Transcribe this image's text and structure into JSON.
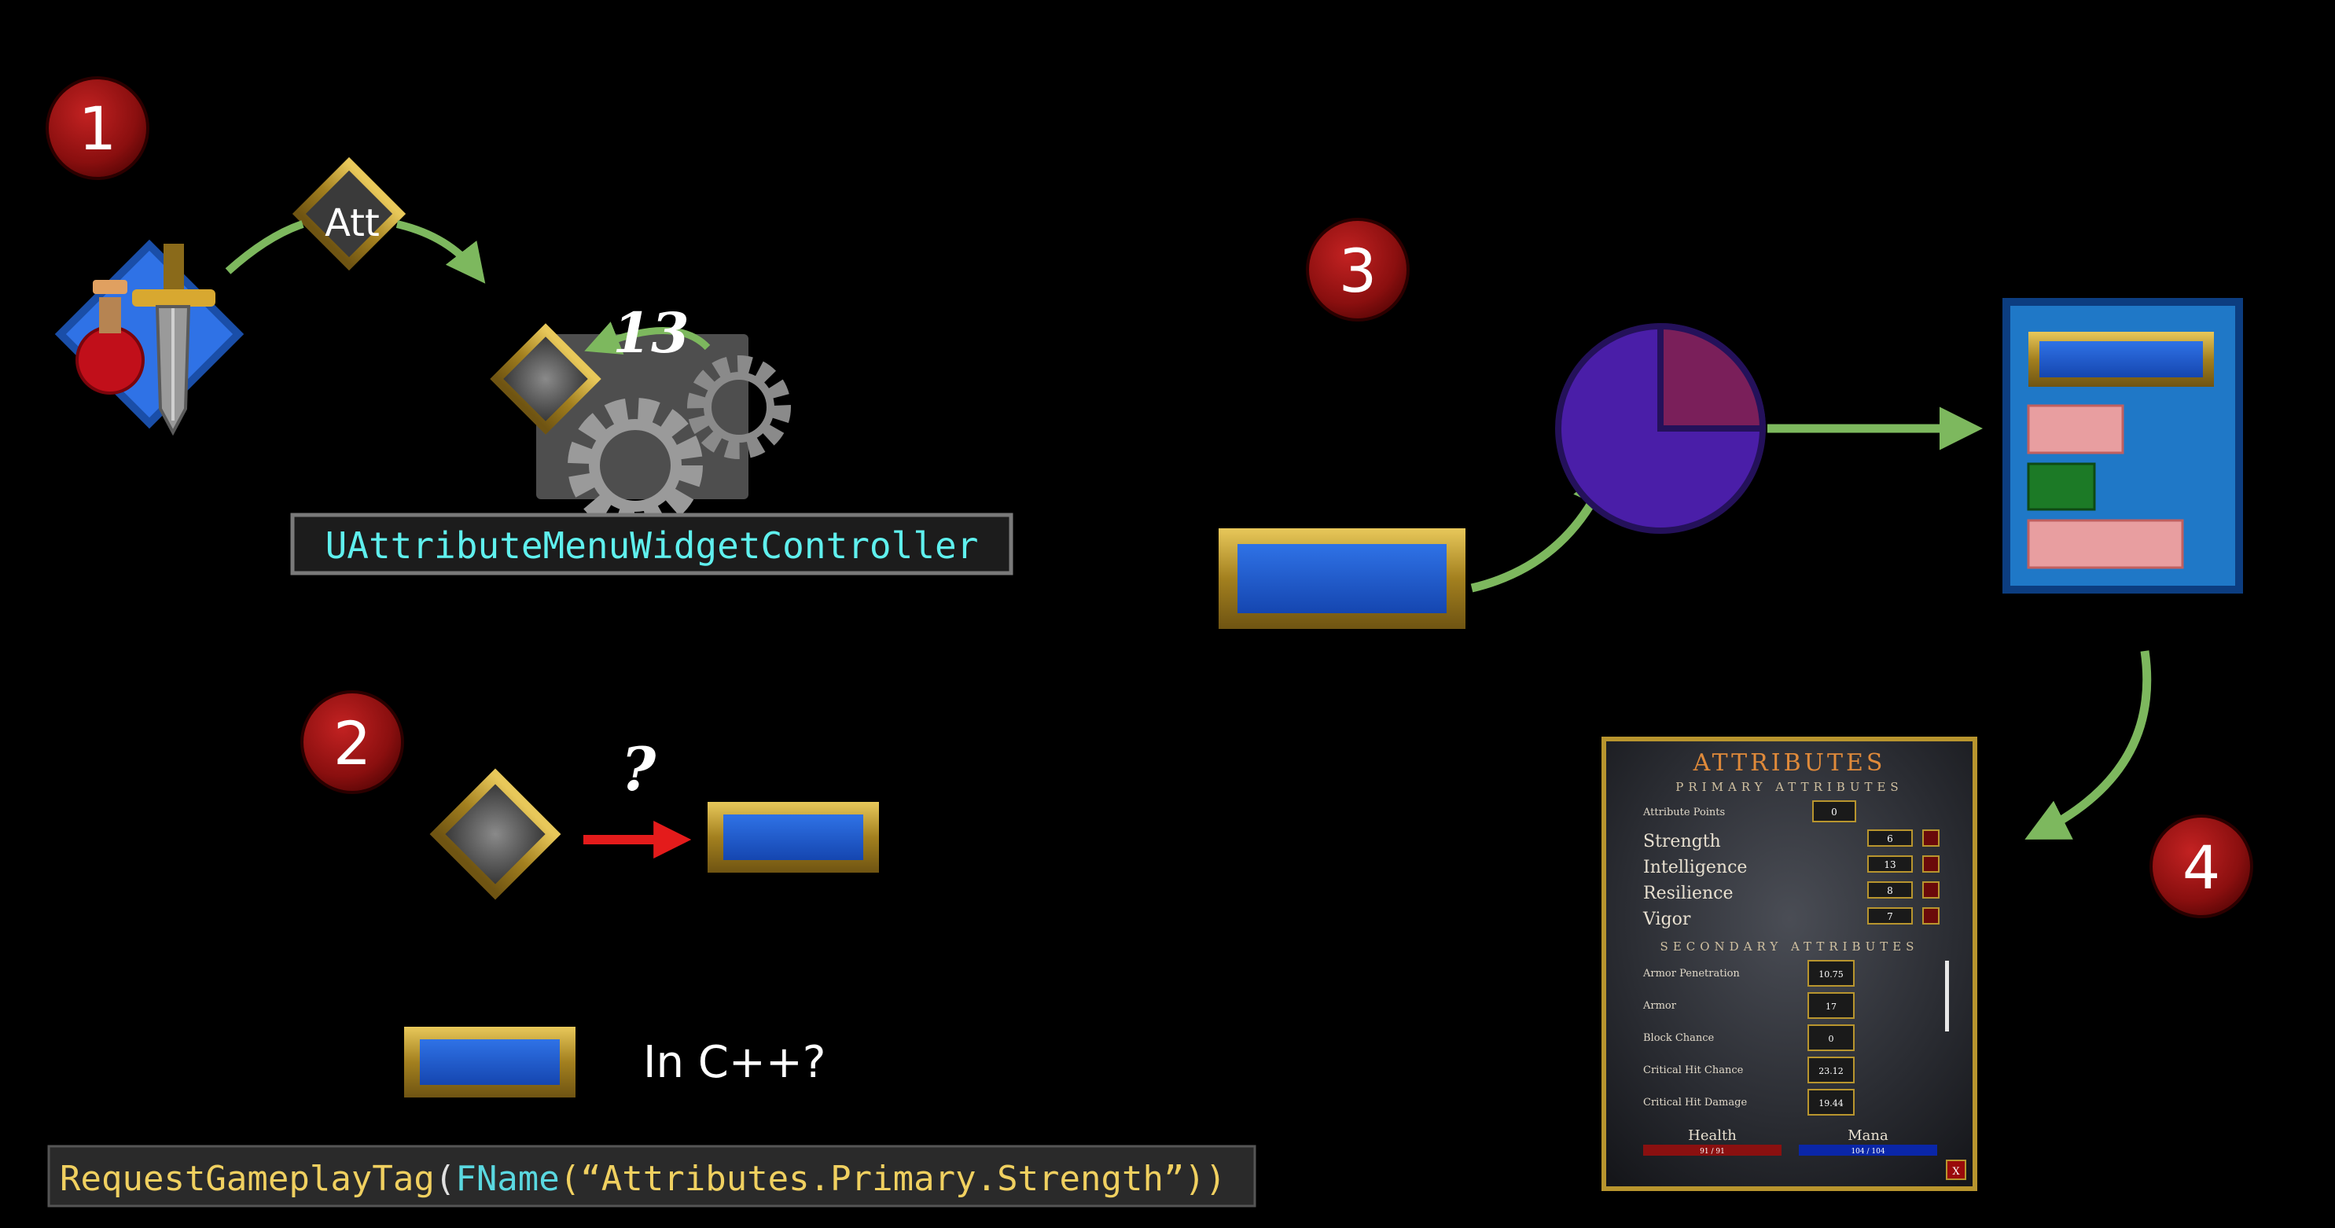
{
  "steps": [
    {
      "number": "1"
    },
    {
      "number": "2"
    },
    {
      "number": "3"
    },
    {
      "number": "4"
    }
  ],
  "step1": {
    "tag_label": "Att",
    "count_label": "13",
    "controller_label": "UAttributeMenuWidgetController"
  },
  "step2": {
    "question_label": "?",
    "in_cpp_label": "In C++?",
    "code_snippet": {
      "func": "RequestGameplayTag",
      "paren_open": "(",
      "type": "FName",
      "arg": "(“Attributes.Primary.Strength”))"
    }
  },
  "attribute_menu": {
    "title": "ATTRIBUTES",
    "primary_heading": "PRIMARY ATTRIBUTES",
    "attribute_points": {
      "label": "Attribute Points",
      "value": "0"
    },
    "primary": [
      {
        "label": "Strength",
        "value": "6"
      },
      {
        "label": "Intelligence",
        "value": "13"
      },
      {
        "label": "Resilience",
        "value": "8"
      },
      {
        "label": "Vigor",
        "value": "7"
      }
    ],
    "secondary_heading": "SECONDARY ATTRIBUTES",
    "secondary": [
      {
        "label": "Armor Penetration",
        "value": "10.75"
      },
      {
        "label": "Armor",
        "value": "17"
      },
      {
        "label": "Block Chance",
        "value": "0"
      },
      {
        "label": "Critical Hit Chance",
        "value": "23.12"
      },
      {
        "label": "Critical Hit Damage",
        "value": "19.44"
      }
    ],
    "health": {
      "label": "Health",
      "value": "91 / 91"
    },
    "mana": {
      "label": "Mana",
      "value": "104 / 104"
    },
    "close_label": "X"
  },
  "colors": {
    "background": "#000000",
    "badge_red": "#8e1010",
    "gold": "#b8952e",
    "widget_blue": "#1b57c9",
    "arrow_green": "#7db85e",
    "arrow_red": "#e41b1b",
    "controller_text": "#5ff0ee",
    "code_yellow": "#f0d060",
    "code_cyan": "#5ad8e0",
    "pie_purple": "#4a1ea8",
    "pie_slice": "#7a1f5a"
  }
}
